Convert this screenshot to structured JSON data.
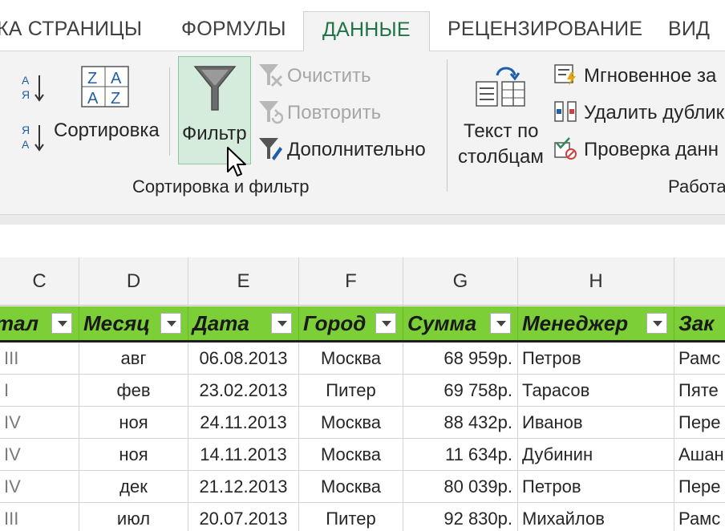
{
  "tabs": [
    {
      "label": "КА СТРАНИЦЫ",
      "active": false
    },
    {
      "label": "ФОРМУЛЫ",
      "active": false
    },
    {
      "label": "ДАННЫЕ",
      "active": true
    },
    {
      "label": "РЕЦЕНЗИРОВАНИЕ",
      "active": false
    },
    {
      "label": "ВИД",
      "active": false
    }
  ],
  "ribbon": {
    "sort_group": {
      "sort_button": "Сортировка",
      "filter_button": "Фильтр",
      "clear": "Очистить",
      "reapply": "Повторить",
      "advanced": "Дополнительно",
      "group_label": "Сортировка и фильтр",
      "sort_az_letters": [
        "А",
        "Я"
      ],
      "sort_za_letters": [
        "Я",
        "А"
      ],
      "sort_dialog_letters": [
        "Z",
        "A",
        "A",
        "Z"
      ]
    },
    "data_tools": {
      "text_to_columns_line1": "Текст по",
      "text_to_columns_line2": "столбцам",
      "flash_fill": "Мгновенное за",
      "remove_duplicates": "Удалить дублик",
      "data_validation": "Проверка данн",
      "group_label": "Работа"
    }
  },
  "columns": [
    "C",
    "D",
    "E",
    "F",
    "G",
    "H",
    ""
  ],
  "table_headers": [
    "тал",
    "Месяц",
    "Дата",
    "Город",
    "Сумма",
    "Менеджер",
    "Зак"
  ],
  "rows": [
    [
      "III",
      "авг",
      "06.08.2013",
      "Москва",
      "68 959р.",
      "Петров",
      "Рамс"
    ],
    [
      "I",
      "фев",
      "23.02.2013",
      "Питер",
      "69 758р.",
      "Тарасов",
      "Пяте"
    ],
    [
      "IV",
      "ноя",
      "24.11.2013",
      "Москва",
      "88 432р.",
      "Иванов",
      "Пере"
    ],
    [
      "IV",
      "ноя",
      "14.11.2013",
      "Москва",
      "11 634р.",
      "Дубинин",
      "Ашан"
    ],
    [
      "IV",
      "дек",
      "21.12.2013",
      "Москва",
      "80 039р.",
      "Петров",
      "Пере"
    ],
    [
      "III",
      "июл",
      "20.07.2013",
      "Питер",
      "92 830р.",
      "Михайлов",
      "Рамс"
    ]
  ],
  "colors": {
    "accent": "#217346",
    "table_header": "#7ccf37",
    "filter_highlight": "#d5ecdc"
  }
}
